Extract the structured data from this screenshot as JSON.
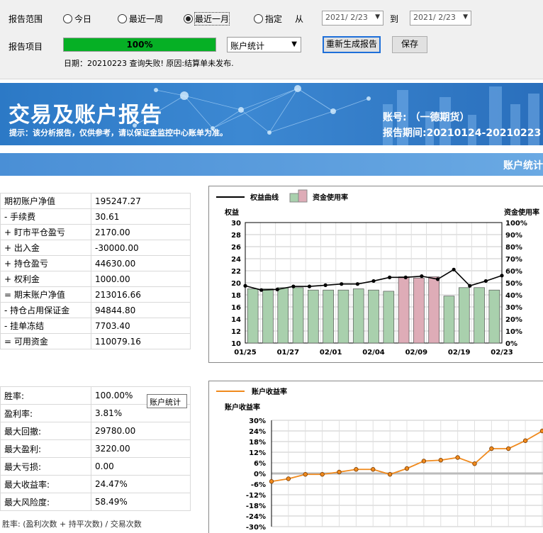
{
  "toolbar": {
    "range_label": "报告范围",
    "range_options": [
      {
        "label": "今日",
        "selected": false
      },
      {
        "label": "最近一周",
        "selected": false
      },
      {
        "label": "最近一月",
        "selected": true
      },
      {
        "label": "指定",
        "selected": false
      }
    ],
    "from_label": "从",
    "from_date": "2021/ 2/23",
    "to_label": "到",
    "to_date": "2021/ 2/23",
    "project_label": "报告项目",
    "progress_text": "100%",
    "progress_value": 1.0,
    "report_select": "账户统计",
    "regenerate_button": "重新生成报告",
    "save_button": "保存",
    "status_message": "日期：20210223 查询失败! 原因:结算单未发布."
  },
  "banner": {
    "title": "交易及账户报告",
    "tip": "提示：该分析报告，仅供参考，请以保证金监控中心账单为准。",
    "account": "账号:          （一德期货）",
    "period": "报告期间:20210124-20210223"
  },
  "section_title": "账户统计",
  "account_table": [
    {
      "k": "期初账户净值",
      "v": "195247.27"
    },
    {
      "k": "- 手续费",
      "v": "30.61"
    },
    {
      "k": "+ 盯市平仓盈亏",
      "v": "2170.00"
    },
    {
      "k": "+ 出入金",
      "v": "-30000.00"
    },
    {
      "k": "+ 持仓盈亏",
      "v": "44630.00"
    },
    {
      "k": "+ 权利金",
      "v": "1000.00"
    },
    {
      "k": "= 期末账户净值",
      "v": "213016.66"
    },
    {
      "k": "- 持仓占用保证金",
      "v": "94844.80"
    },
    {
      "k": "- 挂单冻结",
      "v": "7703.40"
    },
    {
      "k": "= 可用资金",
      "v": "110079.16"
    }
  ],
  "stats_table": [
    {
      "k": "胜率:",
      "v": "100.00%"
    },
    {
      "k": "盈利率:",
      "v": "3.81%"
    },
    {
      "k": "最大回撤:",
      "v": "29780.00"
    },
    {
      "k": "最大盈利:",
      "v": "3220.00"
    },
    {
      "k": "最大亏损:",
      "v": "0.00"
    },
    {
      "k": "最大收益率:",
      "v": "24.47%"
    },
    {
      "k": "最大风险度:",
      "v": "58.49%"
    }
  ],
  "tooltip": "账户统计",
  "footnote": "胜率: (盈利次数 + 持平次数) / 交易次数",
  "chart_data": [
    {
      "type": "bar",
      "legend": [
        "权益曲线",
        "资金使用率"
      ],
      "ylabel_left": "权益",
      "ylabel_right": "资金使用率",
      "left_ticks": [
        "30",
        "28",
        "26",
        "24",
        "22",
        "20",
        "18",
        "16",
        "14",
        "12",
        "10"
      ],
      "right_ticks": [
        "100%",
        "90%",
        "80%",
        "70%",
        "60%",
        "50%",
        "40%",
        "30%",
        "20%",
        "10%",
        "0%"
      ],
      "x_ticks": [
        "01/25",
        "01/27",
        "02/01",
        "02/04",
        "02/09",
        "02/19",
        "02/23"
      ],
      "ylim_left": [
        10,
        30
      ],
      "ylim_right": [
        0,
        100
      ],
      "usage_pct": [
        45,
        45,
        46,
        46,
        44,
        44,
        44,
        45,
        44,
        43,
        55,
        54,
        55,
        39,
        46,
        46,
        44
      ],
      "highlight": [
        false,
        false,
        false,
        false,
        false,
        false,
        false,
        false,
        false,
        false,
        true,
        true,
        true,
        false,
        false,
        false,
        false
      ],
      "equity": [
        19.5,
        18.8,
        18.9,
        19.4,
        19.4,
        19.6,
        19.8,
        19.8,
        20.3,
        20.9,
        20.9,
        21.1,
        20.6,
        22.2,
        19.5,
        20.3,
        21.2
      ],
      "colors": {
        "bar": "#a9d0ad",
        "bar_highlight": "#deacb7",
        "line": "#000000"
      }
    },
    {
      "type": "line",
      "legend": [
        "账户收益率"
      ],
      "ylabel": "账户收益率",
      "y_ticks": [
        "30%",
        "24%",
        "18%",
        "12%",
        "6%",
        "0%",
        "-6%",
        "-12%",
        "-18%",
        "-24%",
        "-30%"
      ],
      "ylim": [
        -30,
        30
      ],
      "values": [
        -4.5,
        -3,
        -0.5,
        -0.5,
        0.8,
        2.3,
        2.3,
        -0.5,
        2.8,
        7,
        7.5,
        9,
        5.5,
        14,
        14,
        18.5,
        24
      ],
      "colors": {
        "line": "#f08a1d",
        "marker_fill": "#f08a1d",
        "marker_stroke": "#7a3b00"
      }
    }
  ]
}
